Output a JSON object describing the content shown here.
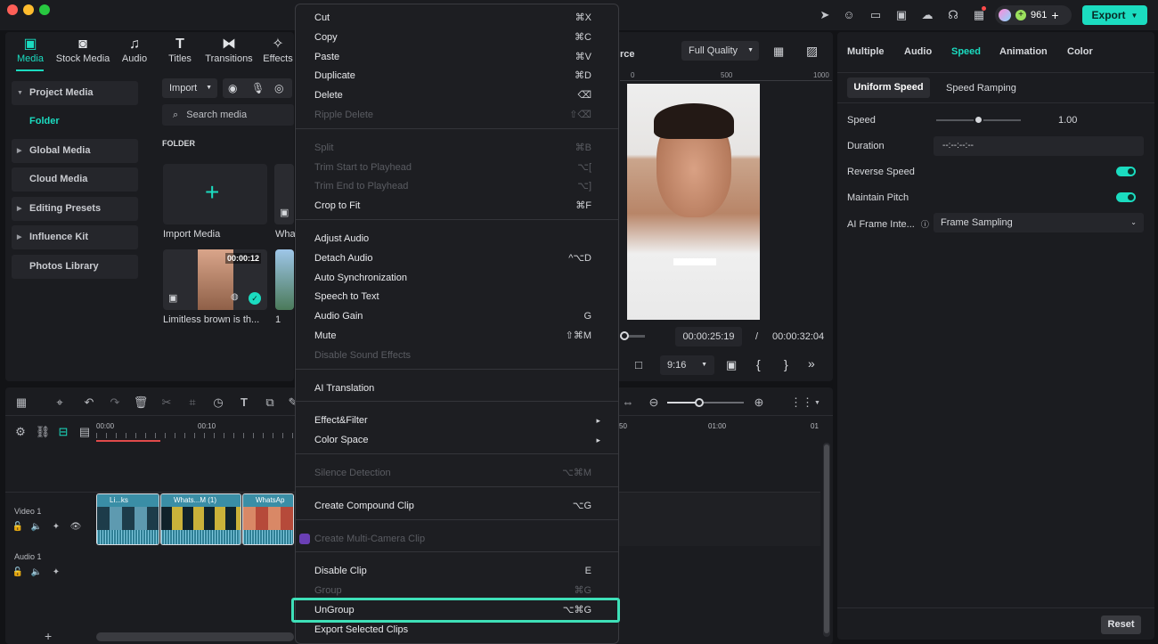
{
  "toolbar": {
    "tabs": [
      {
        "label": "Media",
        "icon": "media-icon",
        "active": true
      },
      {
        "label": "Stock Media",
        "icon": "stock-media-icon"
      },
      {
        "label": "Audio",
        "icon": "music-note-icon"
      },
      {
        "label": "Titles",
        "icon": "text-icon"
      },
      {
        "label": "Transitions",
        "icon": "transition-icon"
      },
      {
        "label": "Effects",
        "icon": "effects-icon"
      }
    ],
    "credits": "961",
    "export_label": "Export"
  },
  "sidebar": {
    "items": [
      {
        "label": "Project Media",
        "expand": "▼"
      },
      {
        "label": "Folder",
        "active": true
      },
      {
        "label": "Global Media",
        "expand": "▶"
      },
      {
        "label": "Cloud Media",
        "expand": ""
      },
      {
        "label": "Editing Presets",
        "expand": "▶"
      },
      {
        "label": "Influence Kit",
        "expand": "▶"
      },
      {
        "label": "Photos Library",
        "expand": ""
      }
    ]
  },
  "media": {
    "import_label": "Import",
    "search_placeholder": "Search media",
    "folder_heading": "FOLDER",
    "tiles": [
      {
        "label": "Import Media"
      },
      {
        "label": "Wha"
      },
      {
        "label": "Limitless brown is th...",
        "duration": "00:00:12"
      },
      {
        "label": "1"
      }
    ]
  },
  "player": {
    "title_fragment": "rce",
    "quality": "Full Quality",
    "ruler": [
      "0",
      "500",
      "1000"
    ],
    "caption": "",
    "current_time": "00:00:25:19",
    "separator": "/",
    "total_time": "00:00:32:04",
    "aspect": "9:16"
  },
  "context_menu": {
    "groups": [
      [
        {
          "label": "Cut",
          "shortcut": "⌘X"
        },
        {
          "label": "Copy",
          "shortcut": "⌘C"
        },
        {
          "label": "Paste",
          "shortcut": "⌘V"
        },
        {
          "label": "Duplicate",
          "shortcut": "⌘D"
        },
        {
          "label": "Delete",
          "shortcut": "⌫"
        },
        {
          "label": "Ripple Delete",
          "shortcut": "⇧⌫",
          "disabled": true
        }
      ],
      [
        {
          "label": "Split",
          "shortcut": "⌘B",
          "disabled": true
        },
        {
          "label": "Trim Start to Playhead",
          "shortcut": "⌥[",
          "disabled": true
        },
        {
          "label": "Trim End to Playhead",
          "shortcut": "⌥]",
          "disabled": true
        },
        {
          "label": "Crop to Fit",
          "shortcut": "⌘F"
        }
      ],
      [
        {
          "label": "Adjust Audio",
          "shortcut": ""
        },
        {
          "label": "Detach Audio",
          "shortcut": "^⌥D"
        },
        {
          "label": "Auto Synchronization",
          "shortcut": ""
        },
        {
          "label": "Speech to Text",
          "shortcut": ""
        },
        {
          "label": "Audio Gain",
          "shortcut": "G"
        },
        {
          "label": "Mute",
          "shortcut": "⇧⌘M"
        },
        {
          "label": "Disable Sound Effects",
          "shortcut": "",
          "disabled": true
        }
      ],
      [
        {
          "label": "AI Translation",
          "shortcut": ""
        }
      ],
      [
        {
          "label": "Effect&Filter",
          "shortcut": "▸"
        },
        {
          "label": "Color Space",
          "shortcut": "▸"
        }
      ],
      [
        {
          "label": "Silence Detection",
          "shortcut": "⌥⌘M",
          "disabled": true
        }
      ],
      [
        {
          "label": "Create Compound Clip",
          "shortcut": "⌥G"
        }
      ],
      [
        {
          "label": "Create Multi-Camera Clip",
          "shortcut": "",
          "disabled": true
        }
      ],
      [
        {
          "label": "Disable Clip",
          "shortcut": "E"
        },
        {
          "label": "Group",
          "shortcut": "⌘G",
          "disabled": true
        },
        {
          "label": "UnGroup",
          "shortcut": "⌥⌘G",
          "highlighted": true
        },
        {
          "label": "Export Selected Clips",
          "shortcut": ""
        }
      ]
    ]
  },
  "right_panel": {
    "tabs": [
      "Multiple",
      "Audio",
      "Speed",
      "Animation",
      "Color"
    ],
    "active_tab": "Speed",
    "subtabs": [
      "Uniform Speed",
      "Speed Ramping"
    ],
    "speed_label": "Speed",
    "speed_value": "1.00",
    "duration_label": "Duration",
    "duration_value": "--:--:--:--",
    "reverse_label": "Reverse Speed",
    "pitch_label": "Maintain Pitch",
    "ai_label": "AI Frame Inte...",
    "ai_value": "Frame Sampling",
    "reset_label": "Reset"
  },
  "timeline": {
    "ruler_left": [
      "00:00",
      "00:10"
    ],
    "ruler_right": [
      "50",
      "01:00",
      "01"
    ],
    "tracks": [
      {
        "label": "Video 1"
      },
      {
        "label": "Audio 1"
      }
    ],
    "clips": [
      {
        "label": "Li...ks"
      },
      {
        "label": "Whats...M (1)"
      },
      {
        "label": "WhatsAp"
      }
    ]
  },
  "colors": {
    "accent": "#1bdcc0",
    "menu_highlight": "#3ee0b8",
    "panel": "#1b1c20",
    "background": "#121316"
  }
}
